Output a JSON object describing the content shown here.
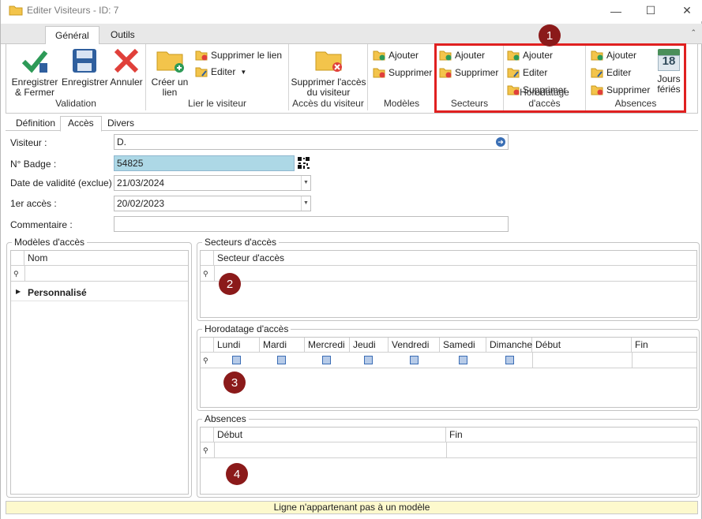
{
  "window": {
    "title": "Editer Visiteurs - ID: 7"
  },
  "ribbon_tabs": [
    "Général",
    "Outils"
  ],
  "ribbon": {
    "validation": {
      "label": "Validation",
      "save_close": "Enregistrer\n& Fermer",
      "save": "Enregistrer",
      "cancel": "Annuler"
    },
    "lier": {
      "label": "Lier le visiteur",
      "create_link": "Créer un\nlien",
      "delete_link": "Supprimer le lien",
      "edit": "Editer"
    },
    "acces": {
      "label": "Accès du visiteur",
      "delete_access": "Supprimer l'accès\ndu visiteur"
    },
    "modeles": {
      "label": "Modèles",
      "add": "Ajouter",
      "delete": "Supprimer"
    },
    "secteurs": {
      "label": "Secteurs",
      "add": "Ajouter",
      "delete": "Supprimer"
    },
    "horodatage": {
      "label": "Horodatage d'accès",
      "add": "Ajouter",
      "edit": "Editer",
      "delete": "Supprimer"
    },
    "absences": {
      "label": "Absences",
      "add": "Ajouter",
      "edit": "Editer",
      "delete": "Supprimer",
      "holidays": "Jours\nfériés",
      "holiday_day": "18"
    }
  },
  "badges": [
    "1",
    "2",
    "3",
    "4"
  ],
  "page_tabs": [
    "Définition",
    "Accès",
    "Divers"
  ],
  "form": {
    "visiteur_label": "Visiteur :",
    "visiteur_value": "D.",
    "badge_label": "N° Badge :",
    "badge_value": "54825",
    "validite_label": "Date de validité (exclue) :",
    "validite_value": "21/03/2024",
    "premier_label": "1er accès :",
    "premier_value": "20/02/2023",
    "commentaire_label": "Commentaire :",
    "commentaire_value": ""
  },
  "modeles": {
    "legend": "Modèles d'accès",
    "col": "Nom",
    "rows": [
      "Personnalisé"
    ]
  },
  "secteurs": {
    "legend": "Secteurs d'accès",
    "col": "Secteur d'accès"
  },
  "horodatage": {
    "legend": "Horodatage d'accès",
    "cols": [
      "Lundi",
      "Mardi",
      "Mercredi",
      "Jeudi",
      "Vendredi",
      "Samedi",
      "Dimanche",
      "Début",
      "Fin"
    ]
  },
  "absences": {
    "legend": "Absences",
    "cols": [
      "Début",
      "Fin"
    ]
  },
  "status": "Ligne n'appartenant pas à un modèle",
  "colors": {
    "highlight": "#e02020",
    "badge": "#8b1a1a",
    "badge_field": "#add8e6",
    "status_bg": "#fdf9cd"
  }
}
